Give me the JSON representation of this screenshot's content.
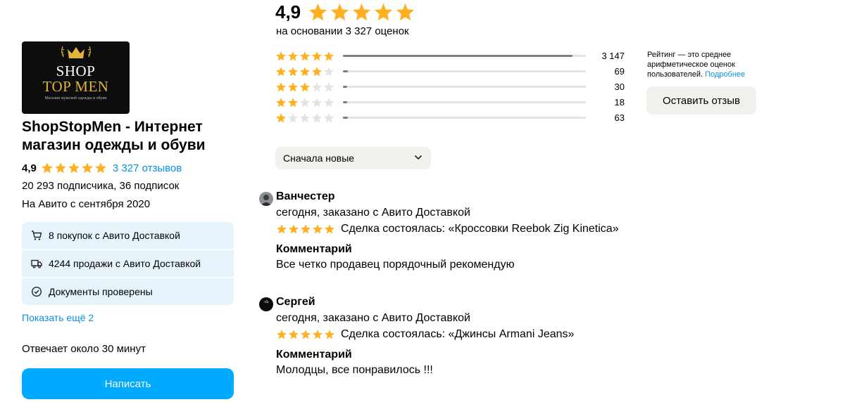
{
  "colors": {
    "accent": "#00aaff",
    "link": "#0a8fe6",
    "star": "#ffb021",
    "star_empty": "#e3e3e3",
    "card": "#e7f4fc"
  },
  "seller": {
    "logo": {
      "line1": "SHOP",
      "line2": "TOP MEN",
      "tagline": "Магазин мужской одежды и обуви"
    },
    "name": "ShopStopMen - Интернет магазин одежды и обуви",
    "rating": "4,9",
    "rating_stars": 5,
    "reviews_link": "3 327 отзывов",
    "subscribers": "20 293 подписчика, 36 подписок",
    "since": "На Авито с сентября 2020",
    "badges": [
      {
        "icon": "cart-icon",
        "text": "8 покупок с Авито Доставкой"
      },
      {
        "icon": "truck-icon",
        "text": "4244 продажи с Авито Доставкой"
      },
      {
        "icon": "check-circle-icon",
        "text": "Документы проверены"
      }
    ],
    "show_more": "Показать ещё 2",
    "response_time": "Отвечает около 30 минут",
    "write_button": "Написать"
  },
  "summary": {
    "rating": "4,9",
    "based_on": "на основании 3 327 оценок",
    "distribution": [
      {
        "stars": 5,
        "count": "3 147",
        "share": 0.946
      },
      {
        "stars": 4,
        "count": "69",
        "share": 0.021
      },
      {
        "stars": 3,
        "count": "30",
        "share": 0.009
      },
      {
        "stars": 2,
        "count": "18",
        "share": 0.005
      },
      {
        "stars": 1,
        "count": "63",
        "share": 0.019
      }
    ],
    "note_text": "Рейтинг — это среднее арифметическое оценок пользователей.",
    "note_link": "Подробнее",
    "leave_review": "Оставить отзыв"
  },
  "sort": {
    "selected": "Сначала новые"
  },
  "reviews": [
    {
      "author": "Ванчестер",
      "meta": "сегодня, заказано с Авито Доставкой",
      "stars": 5,
      "deal": "Сделка состоялась: «Кроссовки Reebok Zig Kinetica»",
      "comment_title": "Комментарий",
      "comment": "Все четко продавец порядочный рекомендую"
    },
    {
      "author": "Сергей",
      "meta": "сегодня, заказано с Авито Доставкой",
      "stars": 5,
      "deal": "Сделка состоялась: «Джинсы Armani Jeans»",
      "comment_title": "Комментарий",
      "comment": "Молодцы, все понравилось !!!"
    }
  ]
}
